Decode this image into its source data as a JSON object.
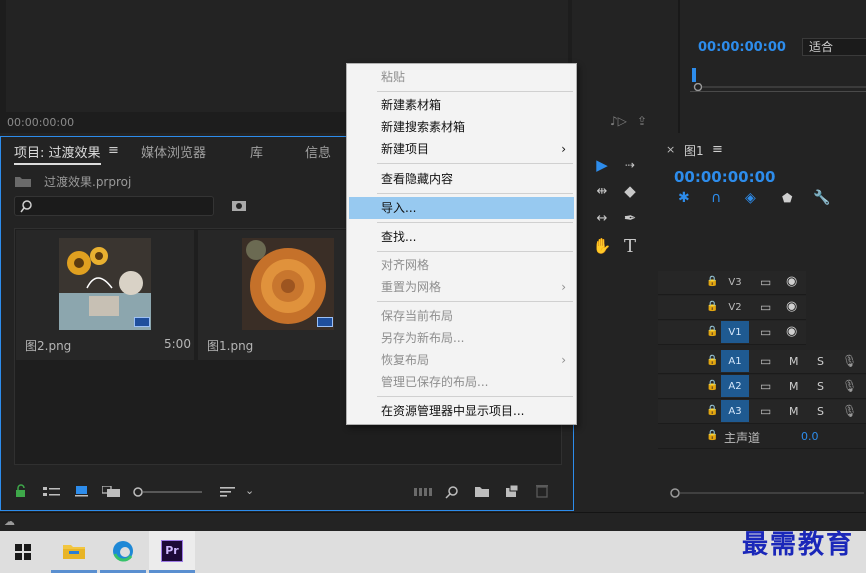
{
  "source_monitor": {
    "timecode": "00:00:00:00"
  },
  "program_monitor": {
    "timecode": "00:00:00:00",
    "fit": "适合"
  },
  "project_panel": {
    "tabs": [
      "项目: 过渡效果",
      "媒体浏览器",
      "库",
      "信息"
    ],
    "project_file": "过渡效果.prproj",
    "search_placeholder": "",
    "clips": [
      {
        "name": "图2.png",
        "duration": "5:00"
      },
      {
        "name": "图1.png",
        "duration": ""
      }
    ]
  },
  "timeline": {
    "title": "图1",
    "timecode": "00:00:00:00",
    "video_tracks": [
      "V3",
      "V2",
      "V1"
    ],
    "audio_tracks": [
      "A1",
      "A2",
      "A3"
    ],
    "master": {
      "label": "主声道",
      "value": "0.0"
    },
    "mute_label": "M",
    "solo_label": "S"
  },
  "context_menu": {
    "items": [
      {
        "label": "粘贴",
        "disabled": true
      },
      {
        "label": "新建素材箱"
      },
      {
        "label": "新建搜索素材箱"
      },
      {
        "label": "新建项目",
        "submenu": true
      },
      {
        "label": "查看隐藏内容"
      },
      {
        "label": "导入...",
        "highlighted": true
      },
      {
        "label": "查找..."
      },
      {
        "label": "对齐网格",
        "disabled": true
      },
      {
        "label": "重置为网格",
        "disabled": true,
        "submenu": true
      },
      {
        "label": "保存当前布局",
        "disabled": true
      },
      {
        "label": "另存为新布局...",
        "disabled": true
      },
      {
        "label": "恢复布局",
        "disabled": true,
        "submenu": true
      },
      {
        "label": "管理已保存的布局...",
        "disabled": true
      },
      {
        "label": "在资源管理器中显示项目..."
      }
    ]
  },
  "taskbar": {
    "apps": [
      "windows-start",
      "file-explorer",
      "edge-browser",
      "premiere-pro"
    ],
    "pr_label": "Pr"
  },
  "watermark": "最需教育",
  "colors": {
    "accent": "#2d8ceb",
    "menu_highlight": "#97c9f0"
  }
}
